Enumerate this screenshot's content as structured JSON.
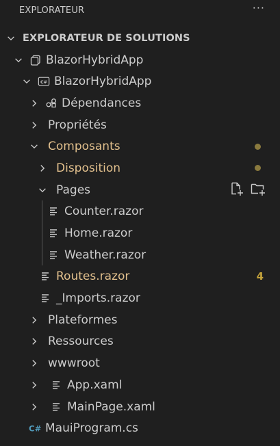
{
  "header": {
    "title": "EXPLORATEUR",
    "more_icon": "more-actions-icon"
  },
  "section": {
    "title": "EXPLORATEUR DE SOLUTIONS"
  },
  "tree": {
    "solution": "BlazorHybridApp",
    "project": "BlazorHybridApp",
    "dependencies": "Dépendances",
    "properties": "Propriétés",
    "components": "Composants",
    "layout": "Disposition",
    "pages": "Pages",
    "counter": "Counter.razor",
    "home": "Home.razor",
    "weather": "Weather.razor",
    "routes": "Routes.razor",
    "routes_badge": "4",
    "imports": "_Imports.razor",
    "platforms": "Plateformes",
    "resources": "Ressources",
    "wwwroot": "wwwroot",
    "app_xaml": "App.xaml",
    "mainpage_xaml": "MainPage.xaml",
    "mauiprogram": "MauiProgram.cs"
  },
  "colors": {
    "background": "#1f1f1f",
    "text": "#cccccc",
    "modified": "#e2c08d",
    "badge": "#c5a33b",
    "dot": "#8a7a3e"
  }
}
